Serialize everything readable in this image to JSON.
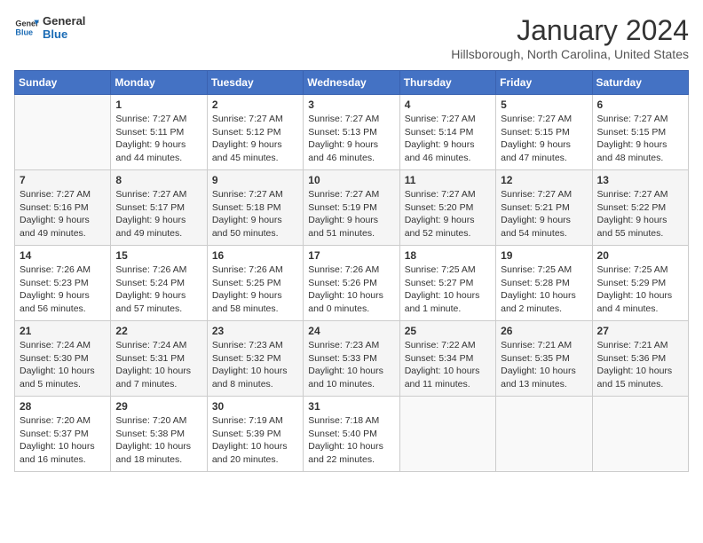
{
  "logo": {
    "text_general": "General",
    "text_blue": "Blue"
  },
  "header": {
    "month": "January 2024",
    "location": "Hillsborough, North Carolina, United States"
  },
  "weekdays": [
    "Sunday",
    "Monday",
    "Tuesday",
    "Wednesday",
    "Thursday",
    "Friday",
    "Saturday"
  ],
  "weeks": [
    [
      {
        "day": "",
        "info": ""
      },
      {
        "day": "1",
        "info": "Sunrise: 7:27 AM\nSunset: 5:11 PM\nDaylight: 9 hours\nand 44 minutes."
      },
      {
        "day": "2",
        "info": "Sunrise: 7:27 AM\nSunset: 5:12 PM\nDaylight: 9 hours\nand 45 minutes."
      },
      {
        "day": "3",
        "info": "Sunrise: 7:27 AM\nSunset: 5:13 PM\nDaylight: 9 hours\nand 46 minutes."
      },
      {
        "day": "4",
        "info": "Sunrise: 7:27 AM\nSunset: 5:14 PM\nDaylight: 9 hours\nand 46 minutes."
      },
      {
        "day": "5",
        "info": "Sunrise: 7:27 AM\nSunset: 5:15 PM\nDaylight: 9 hours\nand 47 minutes."
      },
      {
        "day": "6",
        "info": "Sunrise: 7:27 AM\nSunset: 5:15 PM\nDaylight: 9 hours\nand 48 minutes."
      }
    ],
    [
      {
        "day": "7",
        "info": "Sunrise: 7:27 AM\nSunset: 5:16 PM\nDaylight: 9 hours\nand 49 minutes."
      },
      {
        "day": "8",
        "info": "Sunrise: 7:27 AM\nSunset: 5:17 PM\nDaylight: 9 hours\nand 49 minutes."
      },
      {
        "day": "9",
        "info": "Sunrise: 7:27 AM\nSunset: 5:18 PM\nDaylight: 9 hours\nand 50 minutes."
      },
      {
        "day": "10",
        "info": "Sunrise: 7:27 AM\nSunset: 5:19 PM\nDaylight: 9 hours\nand 51 minutes."
      },
      {
        "day": "11",
        "info": "Sunrise: 7:27 AM\nSunset: 5:20 PM\nDaylight: 9 hours\nand 52 minutes."
      },
      {
        "day": "12",
        "info": "Sunrise: 7:27 AM\nSunset: 5:21 PM\nDaylight: 9 hours\nand 54 minutes."
      },
      {
        "day": "13",
        "info": "Sunrise: 7:27 AM\nSunset: 5:22 PM\nDaylight: 9 hours\nand 55 minutes."
      }
    ],
    [
      {
        "day": "14",
        "info": "Sunrise: 7:26 AM\nSunset: 5:23 PM\nDaylight: 9 hours\nand 56 minutes."
      },
      {
        "day": "15",
        "info": "Sunrise: 7:26 AM\nSunset: 5:24 PM\nDaylight: 9 hours\nand 57 minutes."
      },
      {
        "day": "16",
        "info": "Sunrise: 7:26 AM\nSunset: 5:25 PM\nDaylight: 9 hours\nand 58 minutes."
      },
      {
        "day": "17",
        "info": "Sunrise: 7:26 AM\nSunset: 5:26 PM\nDaylight: 10 hours\nand 0 minutes."
      },
      {
        "day": "18",
        "info": "Sunrise: 7:25 AM\nSunset: 5:27 PM\nDaylight: 10 hours\nand 1 minute."
      },
      {
        "day": "19",
        "info": "Sunrise: 7:25 AM\nSunset: 5:28 PM\nDaylight: 10 hours\nand 2 minutes."
      },
      {
        "day": "20",
        "info": "Sunrise: 7:25 AM\nSunset: 5:29 PM\nDaylight: 10 hours\nand 4 minutes."
      }
    ],
    [
      {
        "day": "21",
        "info": "Sunrise: 7:24 AM\nSunset: 5:30 PM\nDaylight: 10 hours\nand 5 minutes."
      },
      {
        "day": "22",
        "info": "Sunrise: 7:24 AM\nSunset: 5:31 PM\nDaylight: 10 hours\nand 7 minutes."
      },
      {
        "day": "23",
        "info": "Sunrise: 7:23 AM\nSunset: 5:32 PM\nDaylight: 10 hours\nand 8 minutes."
      },
      {
        "day": "24",
        "info": "Sunrise: 7:23 AM\nSunset: 5:33 PM\nDaylight: 10 hours\nand 10 minutes."
      },
      {
        "day": "25",
        "info": "Sunrise: 7:22 AM\nSunset: 5:34 PM\nDaylight: 10 hours\nand 11 minutes."
      },
      {
        "day": "26",
        "info": "Sunrise: 7:21 AM\nSunset: 5:35 PM\nDaylight: 10 hours\nand 13 minutes."
      },
      {
        "day": "27",
        "info": "Sunrise: 7:21 AM\nSunset: 5:36 PM\nDaylight: 10 hours\nand 15 minutes."
      }
    ],
    [
      {
        "day": "28",
        "info": "Sunrise: 7:20 AM\nSunset: 5:37 PM\nDaylight: 10 hours\nand 16 minutes."
      },
      {
        "day": "29",
        "info": "Sunrise: 7:20 AM\nSunset: 5:38 PM\nDaylight: 10 hours\nand 18 minutes."
      },
      {
        "day": "30",
        "info": "Sunrise: 7:19 AM\nSunset: 5:39 PM\nDaylight: 10 hours\nand 20 minutes."
      },
      {
        "day": "31",
        "info": "Sunrise: 7:18 AM\nSunset: 5:40 PM\nDaylight: 10 hours\nand 22 minutes."
      },
      {
        "day": "",
        "info": ""
      },
      {
        "day": "",
        "info": ""
      },
      {
        "day": "",
        "info": ""
      }
    ]
  ]
}
